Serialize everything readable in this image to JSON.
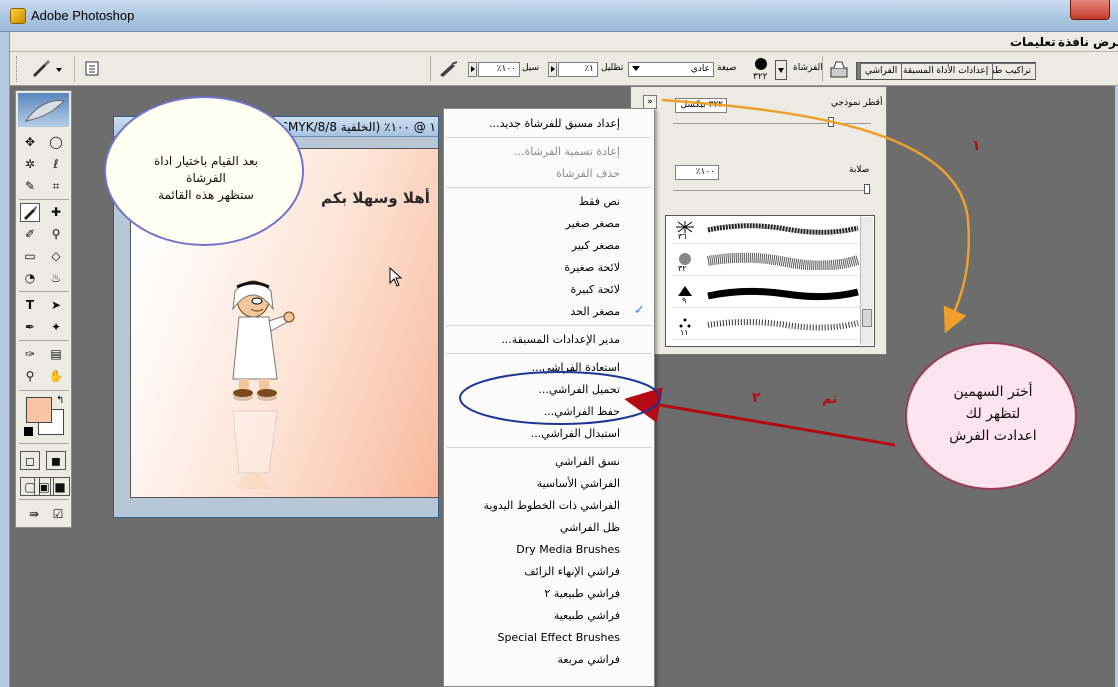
{
  "window": {
    "title": "Adobe Photoshop"
  },
  "menubar": {
    "items": [
      "عرض",
      "نافذة",
      "تعليمات"
    ]
  },
  "options": {
    "brush_label": "الفرشاة",
    "brush_size": "٣٢٢",
    "mode_label": "صيغة",
    "mode_value": "عادي",
    "opacity_label": "تظليل",
    "opacity_value": "١٪",
    "flow_label": "سيل",
    "flow_value": "١٠٠٪",
    "tabs": [
      "تراكيب طبقة",
      "إعدادات الأداة المسبقة",
      "الفراشي"
    ]
  },
  "panel": {
    "master_diameter_label": "أقطر نموذجي",
    "master_diameter_value": "٣٢٢ بيكسل",
    "hardness_label": "صلابة",
    "hardness_value": "١٠٠٪",
    "brushes": [
      "٣٦",
      "٣٢",
      "٩",
      "١١"
    ]
  },
  "document": {
    "title": "١ @ ١٠٠٪ (الخلفية 8/8/CMYK",
    "canvas_text": "أهلا وسهلا بكم"
  },
  "menu": {
    "items": [
      {
        "label": "إعداد مسبق للفرشاة جديد...",
        "disabled": false,
        "sep_after": true
      },
      {
        "label": "إعادة تسمية الفرشاة...",
        "disabled": true,
        "sep_after": false
      },
      {
        "label": "حذف الفرشاة",
        "disabled": true,
        "sep_after": true
      },
      {
        "label": "نص فقط",
        "disabled": false,
        "sep_after": false
      },
      {
        "label": "مصغر صغير",
        "disabled": false,
        "sep_after": false
      },
      {
        "label": "مصغر كبير",
        "disabled": false,
        "sep_after": false
      },
      {
        "label": "لائحة صغيرة",
        "disabled": false,
        "sep_after": false
      },
      {
        "label": "لائحة كبيرة",
        "disabled": false,
        "sep_after": false
      },
      {
        "label": "مصغر الحد",
        "disabled": false,
        "checked": true,
        "sep_after": true
      },
      {
        "label": "مدير الإعدادات المسبقة...",
        "disabled": false,
        "sep_after": true
      },
      {
        "label": "استعادة الفراشي...",
        "disabled": false,
        "sep_after": false
      },
      {
        "label": "تحميل الفراشي...",
        "disabled": false,
        "sep_after": false
      },
      {
        "label": "حفظ الفراشي...",
        "disabled": false,
        "sep_after": false
      },
      {
        "label": "استبدال الفراشي...",
        "disabled": false,
        "sep_after": true
      },
      {
        "label": "نسق الفراشي",
        "disabled": false,
        "sep_after": false
      },
      {
        "label": "الفراشي الأساسية",
        "disabled": false,
        "sep_after": false
      },
      {
        "label": "الفراشي ذات الخطوط اليدوية",
        "disabled": false,
        "sep_after": false
      },
      {
        "label": "ظل الفراشي",
        "disabled": false,
        "sep_after": false
      },
      {
        "label": "Dry Media Brushes",
        "disabled": false,
        "sep_after": false
      },
      {
        "label": "فراشي الإنهاء الزائف",
        "disabled": false,
        "sep_after": false
      },
      {
        "label": "فراشي طبيعية ٢",
        "disabled": false,
        "sep_after": false
      },
      {
        "label": "فراشي طبيعية",
        "disabled": false,
        "sep_after": false
      },
      {
        "label": "Special Effect Brushes",
        "disabled": false,
        "sep_after": false
      },
      {
        "label": "فراشي مربعة",
        "disabled": false,
        "sep_after": false
      }
    ]
  },
  "annotations": {
    "callout_left": [
      "بعد القيام باختيار اداة",
      "الفرشاة",
      "ستظهر هذه القائمة"
    ],
    "callout_right": [
      "أختر السهمين",
      "لتظهر لك",
      "اعدادت الفرش"
    ],
    "step1": "١",
    "step2": "٢",
    "then": "ثم"
  },
  "colors": {
    "foreground": "#fbc4a4",
    "background": "#ffffff",
    "arrow_orange": "#f0a02a",
    "arrow_red": "#b40a14",
    "ellipse": "#1f3596"
  }
}
